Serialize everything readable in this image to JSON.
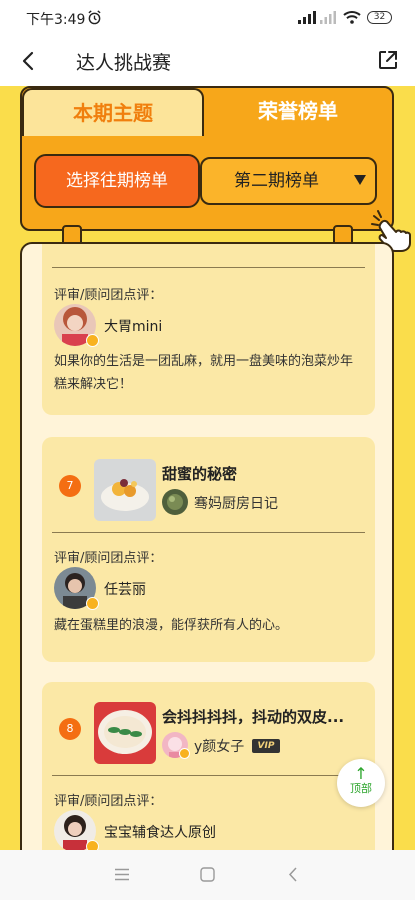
{
  "status_bar": {
    "time": "下午3:49",
    "battery": "32",
    "icons": [
      "alarm-icon",
      "signal-icon",
      "wifi-icon",
      "battery-icon"
    ]
  },
  "header": {
    "title": "达人挑战赛",
    "left_icon": "back-arrow-icon",
    "right_icon": "share-icon"
  },
  "tabs": [
    {
      "label": "本期主题",
      "active": false
    },
    {
      "label": "荣誉榜单",
      "active": true
    }
  ],
  "controls": {
    "select_button": "选择往期榜单",
    "selected_issue": "第二期榜单"
  },
  "colors": {
    "background": "#fadd4b",
    "panel": "#f7a71a",
    "accent": "#f6681e",
    "card": "#fbe8a6"
  },
  "entries": [
    {
      "review_label": "评审/顾问团点评：",
      "reviewer": "大胃mini",
      "review": "如果你的生活是一团乱麻，就用一盘美味的泡菜炒年糕来解决它！"
    },
    {
      "rank": "7",
      "title": "甜蜜的秘密",
      "author": "骞妈厨房日记",
      "review_label": "评审/顾问团点评：",
      "reviewer": "任芸丽",
      "review": "藏在蛋糕里的浪漫，能俘获所有人的心。"
    },
    {
      "rank": "8",
      "title": "会抖抖抖抖，抖动的双皮...",
      "author": "y颜女子",
      "badge": "VIP",
      "review_label": "评审/顾问团点评：",
      "reviewer": "宝宝辅食达人原创"
    }
  ],
  "back_to_top": {
    "arrow": "↑",
    "label": "顶部"
  }
}
